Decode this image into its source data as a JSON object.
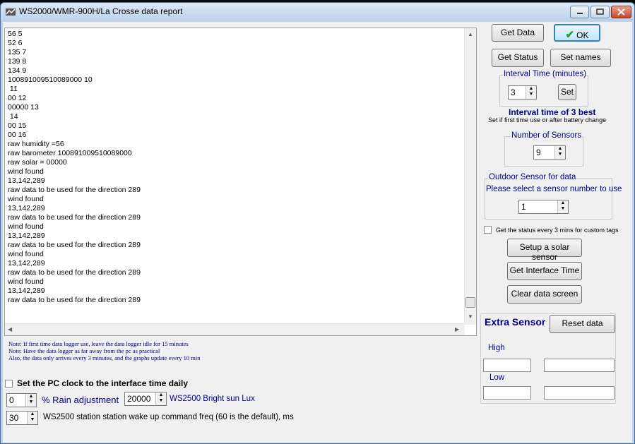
{
  "window": {
    "title": "WS2000/WMR-900H/La Crosse data report"
  },
  "log_lines": [
    "56 5",
    "52 6",
    "135 7",
    "139 8",
    "134 9",
    "100891009510089000 10",
    " 11",
    "00 12",
    "00000 13",
    " 14",
    "00 15",
    "00 16",
    "raw humidity =56",
    "raw barometer 100891009510089000",
    "raw solar = 00000",
    "wind found",
    "13,142,289",
    "raw data to be used for the direction 289",
    "wind found",
    "13,142,289",
    "raw data to be used for the direction 289",
    "wind found",
    "13,142,289",
    "raw data to be used for the direction 289",
    "wind found",
    "13,142,289",
    "raw data to be used for the direction 289",
    "wind found",
    "13,142,289",
    "raw data to be used for the direction 289"
  ],
  "buttons": {
    "get_data": "Get Data",
    "ok": "OK",
    "get_status": "Get Status",
    "set_names": "Set names",
    "set": "Set",
    "setup_solar": "Setup a solar sensor",
    "get_interface_time": "Get Interface Time",
    "clear_screen": "Clear data screen",
    "reset_data": "Reset data"
  },
  "interval": {
    "legend": "Interval Time (minutes)",
    "value": "3",
    "summary": "Interval time of 3 best",
    "hint": "Set if first time use or after battery change"
  },
  "sensors": {
    "legend": "Number of Sensors",
    "value": "9"
  },
  "outdoor": {
    "legend": "Outdoor Sensor for data",
    "prompt": "Please select a sensor number to use",
    "value": "1"
  },
  "status_check_label": "Get the status every 3 mins for custom tags",
  "notes": [
    "Note: If first time data logger use, leave the data logger idle for 15 minutes",
    "Note: Have the data logger as far away from the pc as practical",
    "Also, the data only arrives every 3 minutes, and the graphs update every 10 min"
  ],
  "pc_clock_label": "Set the PC clock to the interface time daily",
  "rain": {
    "value": "0",
    "label": "% Rain adjustment"
  },
  "bright": {
    "value": "20000",
    "label": "WS2500 Bright sun Lux"
  },
  "wakeup": {
    "value": "30",
    "label": "WS2500 station station wake up command freq (60 is the default), ms"
  },
  "extra_sensor": {
    "title": "Extra Sensor",
    "high": "High",
    "low": "Low"
  },
  "colors": {
    "accent": "#00008b",
    "title_bg": "#bcd3ea",
    "ok_border": "#3c7fb1"
  }
}
